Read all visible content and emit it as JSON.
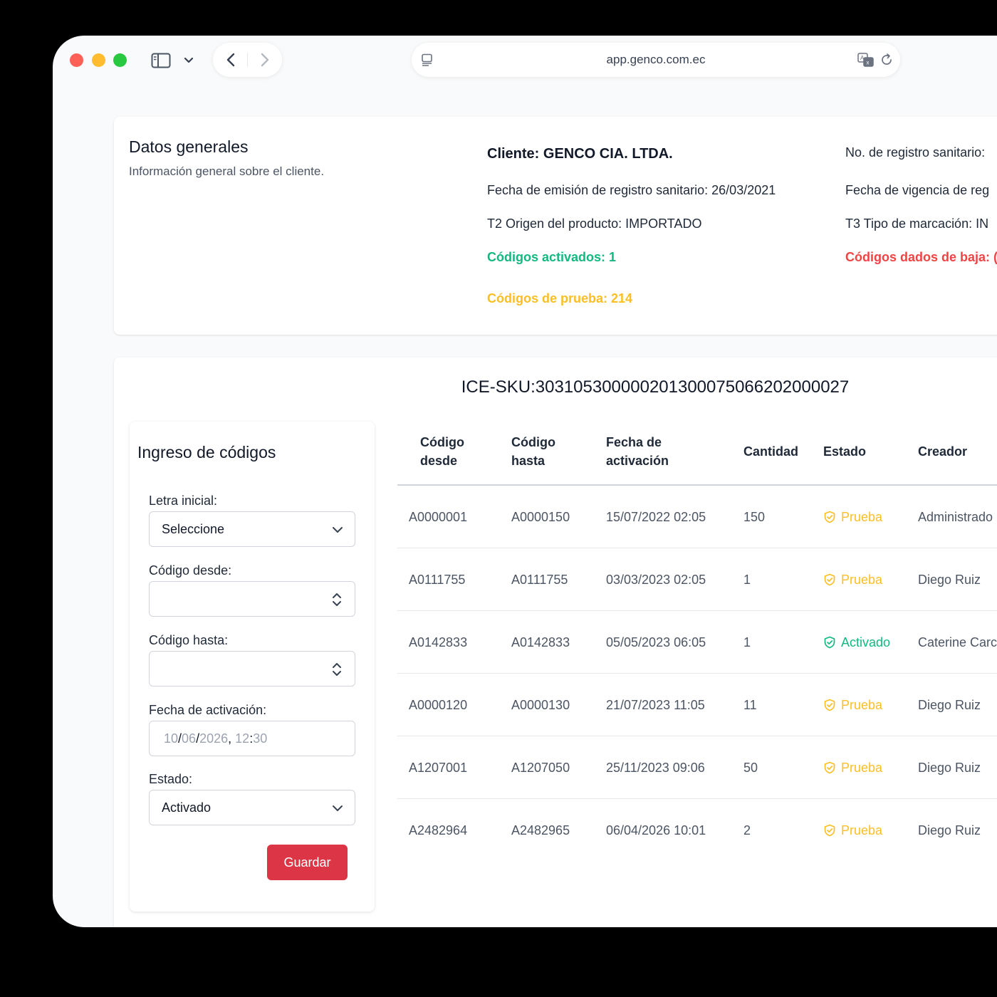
{
  "browser": {
    "url": "app.genco.com.ec"
  },
  "general": {
    "title": "Datos generales",
    "subtitle": "Información general sobre el cliente.",
    "cliente": "Cliente: GENCO CIA. LTDA.",
    "registro_sanitario": "No. de registro sanitario:",
    "fecha_emision": "Fecha de emisión de registro sanitario: 26/03/2021",
    "fecha_vigencia": "Fecha de vigencia de reg",
    "origen": "T2 Origen del producto: IMPORTADO",
    "tipo_marcacion": "T3 Tipo de marcación: IN",
    "codigos_activados": "Códigos activados: 1",
    "codigos_baja": "Códigos dados de baja: (",
    "codigos_prueba": "Códigos de prueba: 214"
  },
  "sku": "ICE-SKU: 30310530000020130007506620200002 7",
  "form": {
    "title": "Ingreso de códigos",
    "letra_label": "Letra inicial:",
    "letra_value": "Seleccione",
    "desde_label": "Código desde:",
    "hasta_label": "Código hasta:",
    "fecha_label": "Fecha de activación:",
    "fecha_day": "10",
    "fecha_month": "06",
    "fecha_year": "2026",
    "fecha_hour": "12",
    "fecha_min": "30",
    "estado_label": "Estado:",
    "estado_value": "Activado",
    "save_label": "Guardar"
  },
  "table": {
    "headers": [
      "Código desde",
      "Código hasta",
      "Fecha de activación",
      "Cantidad",
      "Estado",
      "Creador"
    ],
    "rows": [
      {
        "desde": "A0000001",
        "hasta": "A0000150",
        "fecha": "15/07/2022 02:05",
        "cantidad": "150",
        "estado": "Prueba",
        "creador": "Administrado"
      },
      {
        "desde": "A0111755",
        "hasta": "A0111755",
        "fecha": "03/03/2023 02:05",
        "cantidad": "1",
        "estado": "Prueba",
        "creador": "Diego Ruiz"
      },
      {
        "desde": "A0142833",
        "hasta": "A0142833",
        "fecha": "05/05/2023 06:05",
        "cantidad": "1",
        "estado": "Activado",
        "creador": "Caterine Carc"
      },
      {
        "desde": "A0000120",
        "hasta": "A0000130",
        "fecha": "21/07/2023 11:05",
        "cantidad": "11",
        "estado": "Prueba",
        "creador": "Diego Ruiz"
      },
      {
        "desde": "A1207001",
        "hasta": "A1207050",
        "fecha": "25/11/2023 09:06",
        "cantidad": "50",
        "estado": "Prueba",
        "creador": "Diego Ruiz"
      },
      {
        "desde": "A2482964",
        "hasta": "A2482965",
        "fecha": "06/04/2026 10:01",
        "cantidad": "2",
        "estado": "Prueba",
        "creador": "Diego Ruiz"
      }
    ]
  },
  "colors": {
    "prueba": "#fbbf24",
    "activado": "#10b981",
    "baja": "#ef4444",
    "save_button": "#dc3545"
  }
}
